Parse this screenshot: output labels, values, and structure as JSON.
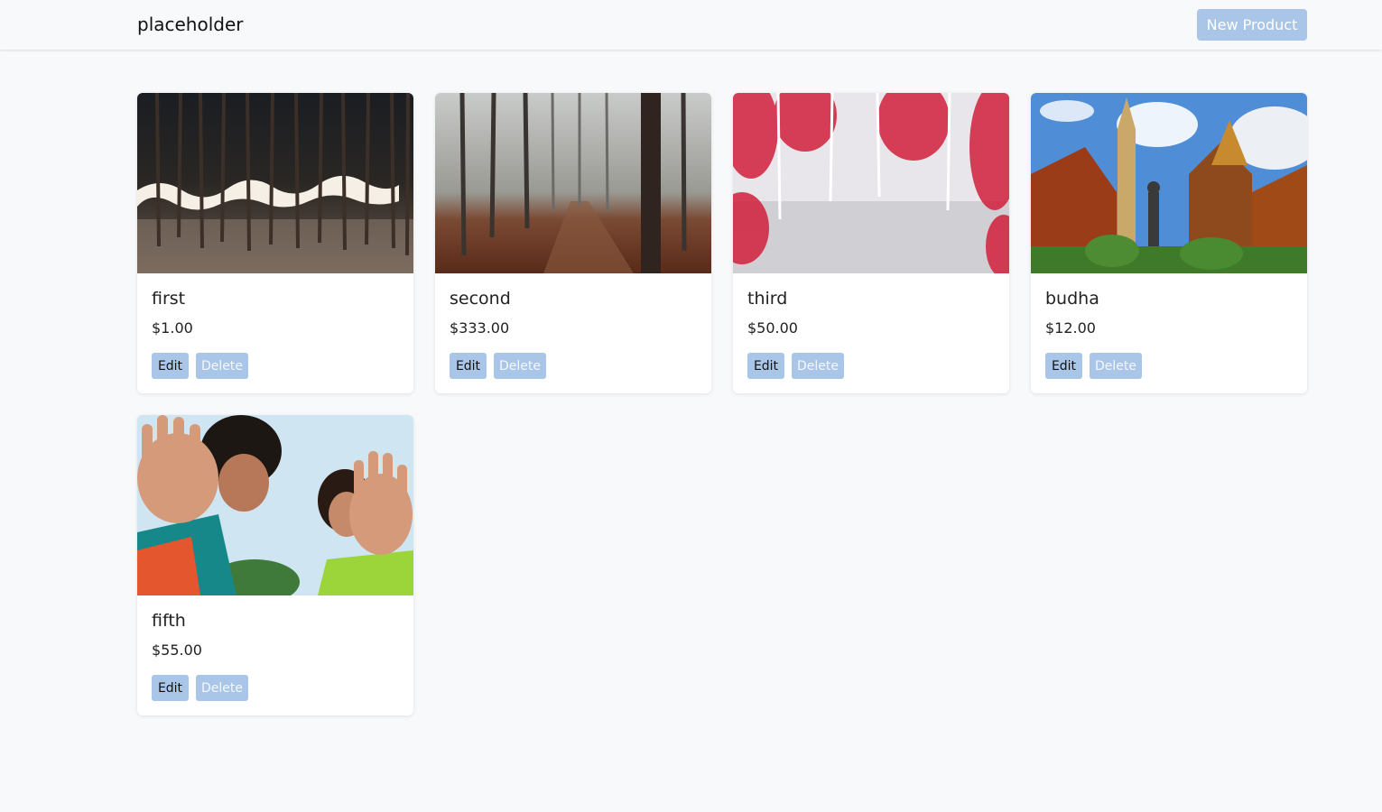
{
  "header": {
    "brand": "placeholder",
    "new_product_label": "New Product"
  },
  "actions": {
    "edit_label": "Edit",
    "delete_label": "Delete"
  },
  "colors": {
    "background": "#f8f9fb",
    "button": "#a9c6e8",
    "card": "#ffffff"
  },
  "products": [
    {
      "title": "first",
      "price": "$1.00",
      "image": "night-forest-light-trail-photo"
    },
    {
      "title": "second",
      "price": "$333.00",
      "image": "foggy-forest-path-photo"
    },
    {
      "title": "third",
      "price": "$50.00",
      "image": "infrared-red-forest-photo"
    },
    {
      "title": "budha",
      "price": "$12.00",
      "image": "thai-temple-statue-photo"
    },
    {
      "title": "fifth",
      "price": "$55.00",
      "image": "two-people-waving-hands-photo"
    }
  ]
}
